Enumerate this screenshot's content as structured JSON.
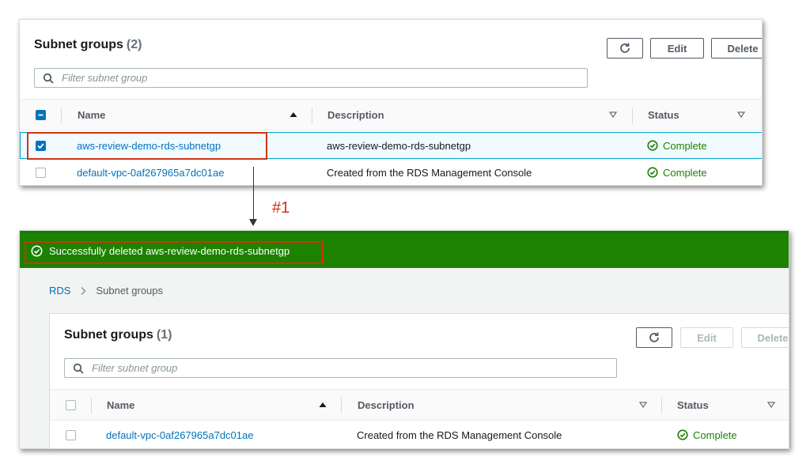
{
  "before": {
    "title": "Subnet groups",
    "count": "(2)",
    "buttons": {
      "edit": "Edit",
      "delete": "Delete"
    },
    "filter_placeholder": "Filter subnet group",
    "columns": {
      "name": "Name",
      "description": "Description",
      "status": "Status"
    },
    "rows": [
      {
        "name": "aws-review-demo-rds-subnetgp",
        "description": "aws-review-demo-rds-subnetgp",
        "status": "Complete",
        "selected": true
      },
      {
        "name": "default-vpc-0af267965a7dc01ae",
        "description": "Created from the RDS Management Console",
        "status": "Complete",
        "selected": false
      }
    ]
  },
  "step_label": "#1",
  "after": {
    "banner": "Successfully deleted aws-review-demo-rds-subnetgp",
    "breadcrumb": {
      "root": "RDS",
      "current": "Subnet groups"
    },
    "title": "Subnet groups",
    "count": "(1)",
    "buttons": {
      "edit": "Edit",
      "delete": "Delete"
    },
    "filter_placeholder": "Filter subnet group",
    "columns": {
      "name": "Name",
      "description": "Description",
      "status": "Status"
    },
    "rows": [
      {
        "name": "default-vpc-0af267965a7dc01ae",
        "description": "Created from the RDS Management Console",
        "status": "Complete",
        "selected": false
      }
    ]
  },
  "colors": {
    "success_green": "#1d8102",
    "link_blue": "#0073bb",
    "highlight_red": "#d13212"
  }
}
